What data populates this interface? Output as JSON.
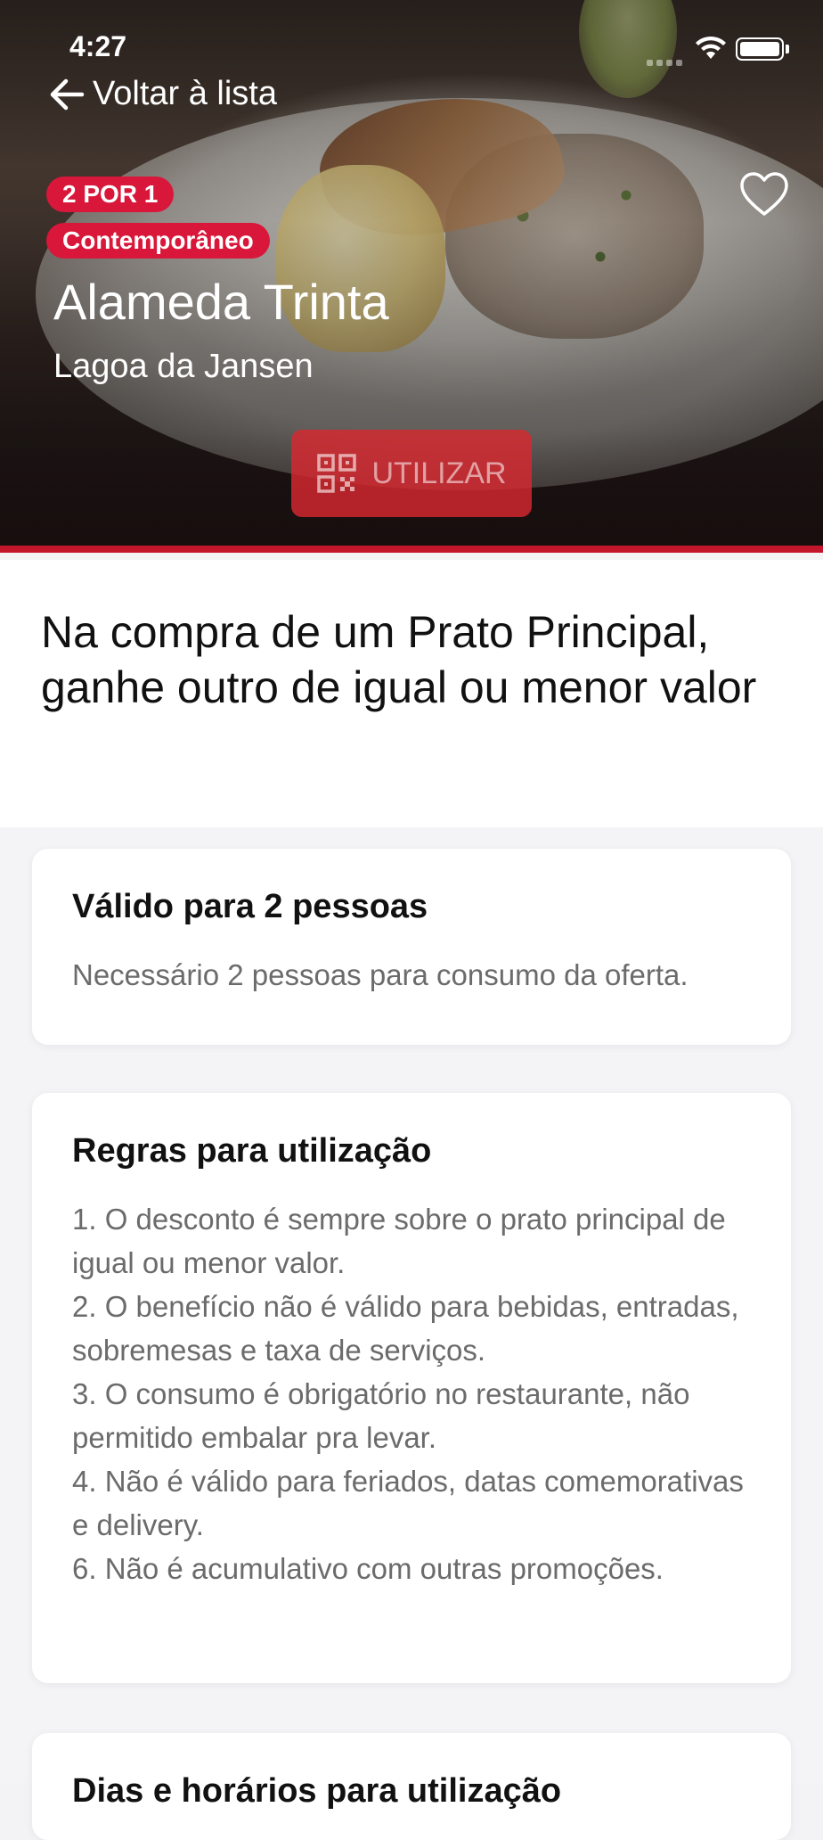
{
  "status_bar": {
    "time": "4:27"
  },
  "nav": {
    "back_label": "Voltar à lista"
  },
  "hero": {
    "badges": [
      "2 POR 1",
      "Contemporâneo"
    ],
    "title": "Alameda Trinta",
    "subtitle": "Lagoa da Jansen",
    "use_button": "UTILIZAR",
    "favorite_icon": "heart-outline-icon",
    "qr_icon": "qr-code-icon"
  },
  "offer": {
    "description": "Na compra de um Prato Principal, ganhe outro de igual ou menor valor"
  },
  "cards": [
    {
      "title": "Válido para 2 pessoas",
      "body": "Necessário 2 pessoas para consumo da oferta."
    },
    {
      "title": "Regras para utilização",
      "rules": [
        "1. O desconto é sempre sobre o prato principal de igual ou menor valor.",
        "2. O benefício não é válido para bebidas, entradas, sobremesas e taxa de serviços.",
        "3. O consumo é obrigatório no restaurante, não permitido embalar pra levar.",
        "4. Não é válido para feriados, datas comemorativas e delivery.",
        "6. Não é acumulativo com outras promoções."
      ]
    },
    {
      "title": "Dias e horários para utilização"
    }
  ],
  "colors": {
    "accent": "#d9173a",
    "divider": "#c4162a"
  }
}
